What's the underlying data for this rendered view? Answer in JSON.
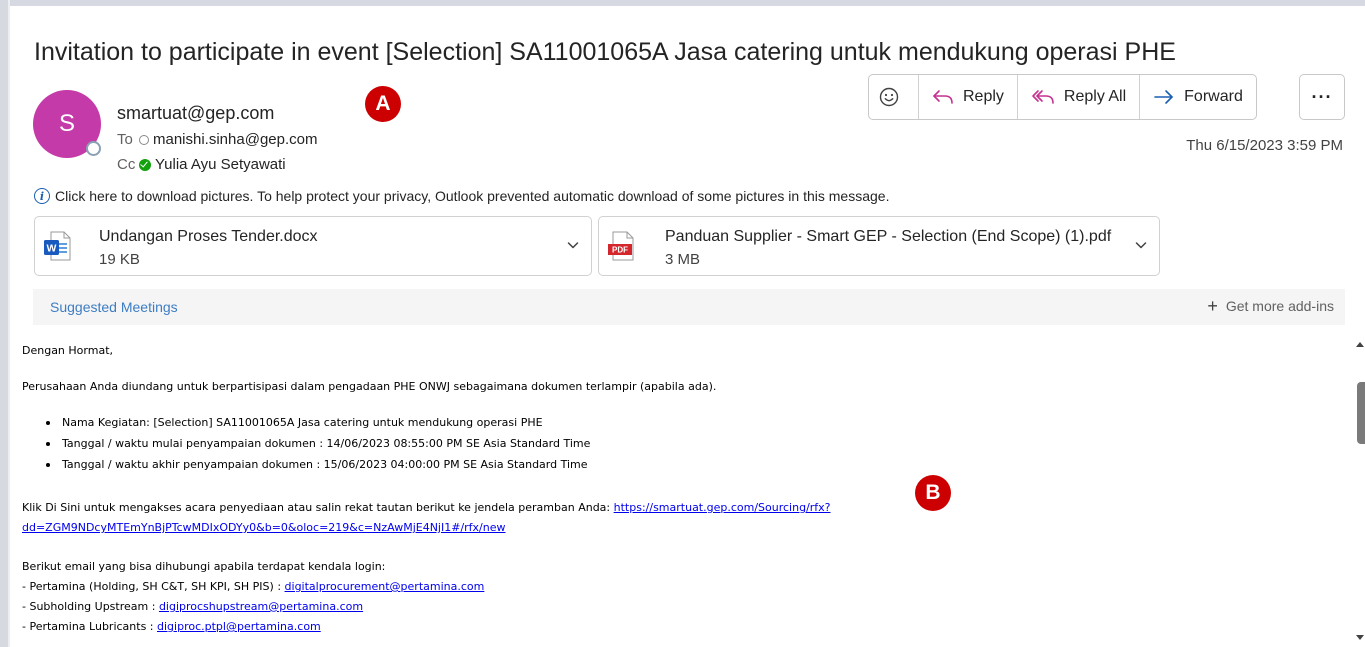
{
  "subject": "Invitation to participate in event [Selection] SA11001065A Jasa catering untuk mendukung operasi PHE",
  "sender": {
    "initial": "S",
    "email": "smartuat@gep.com",
    "avatar_color": "#c43aa8"
  },
  "to": {
    "label": "To",
    "value": "manishi.sinha@gep.com"
  },
  "cc": {
    "label": "Cc",
    "value": "Yulia Ayu Setyawati"
  },
  "markers": {
    "a": "A",
    "b": "B"
  },
  "actions": {
    "emoji": "emoji-icon",
    "reply": "Reply",
    "reply_all": "Reply All",
    "forward": "Forward",
    "more": "···"
  },
  "date": "Thu 6/15/2023 3:59 PM",
  "info_bar": "Click here to download pictures. To help protect your privacy, Outlook prevented automatic download of some pictures in this message.",
  "attachments": [
    {
      "name": "Undangan Proses Tender.docx",
      "size": "19 KB",
      "icon": "word-doc-icon"
    },
    {
      "name": "Panduan Supplier - Smart GEP - Selection (End Scope) (1).pdf",
      "size": "3 MB",
      "icon": "pdf-icon"
    }
  ],
  "addins": {
    "suggested": "Suggested Meetings",
    "get_more": "Get more add-ins"
  },
  "body": {
    "greeting": "Dengan Hormat,",
    "intro": "Perusahaan Anda diundang untuk berpartisipasi dalam pengadaan PHE ONWJ sebagaimana dokumen terlampir (apabila ada).",
    "bullets": [
      "Nama Kegiatan:  [Selection] SA11001065A Jasa catering untuk mendukung operasi PHE",
      "Tanggal / waktu mulai penyampaian dokumen : 14/06/2023 08:55:00 PM SE Asia Standard Time",
      "Tanggal / waktu akhir penyampaian dokumen : 15/06/2023 04:00:00 PM SE Asia Standard Time"
    ],
    "link_text": "Klik Di Sini untuk mengakses acara penyediaan atau salin rekat tautan berikut ke jendela peramban Anda:",
    "link_part1": "https://smartuat.gep.com/Sourcing/rfx?",
    "link_part2": "dd=ZGM9NDcyMTEmYnBjPTcwMDIxODYy0&b=0&oloc=219&c=NzAwMjE4NjI1#/rfx/new",
    "contact_intro": "Berikut email yang bisa dihubungi apabila terdapat kendala login:",
    "contacts": [
      {
        "label": "- Pertamina (Holding, SH C&T, SH KPI, SH PIS) : ",
        "email": "digitalprocurement@pertamina.com"
      },
      {
        "label": "- Subholding Upstream : ",
        "email": "digiprocshupstream@pertamina.com"
      },
      {
        "label": "- Pertamina Lubricants : ",
        "email": "digiproc.ptpl@pertamina.com"
      }
    ]
  }
}
